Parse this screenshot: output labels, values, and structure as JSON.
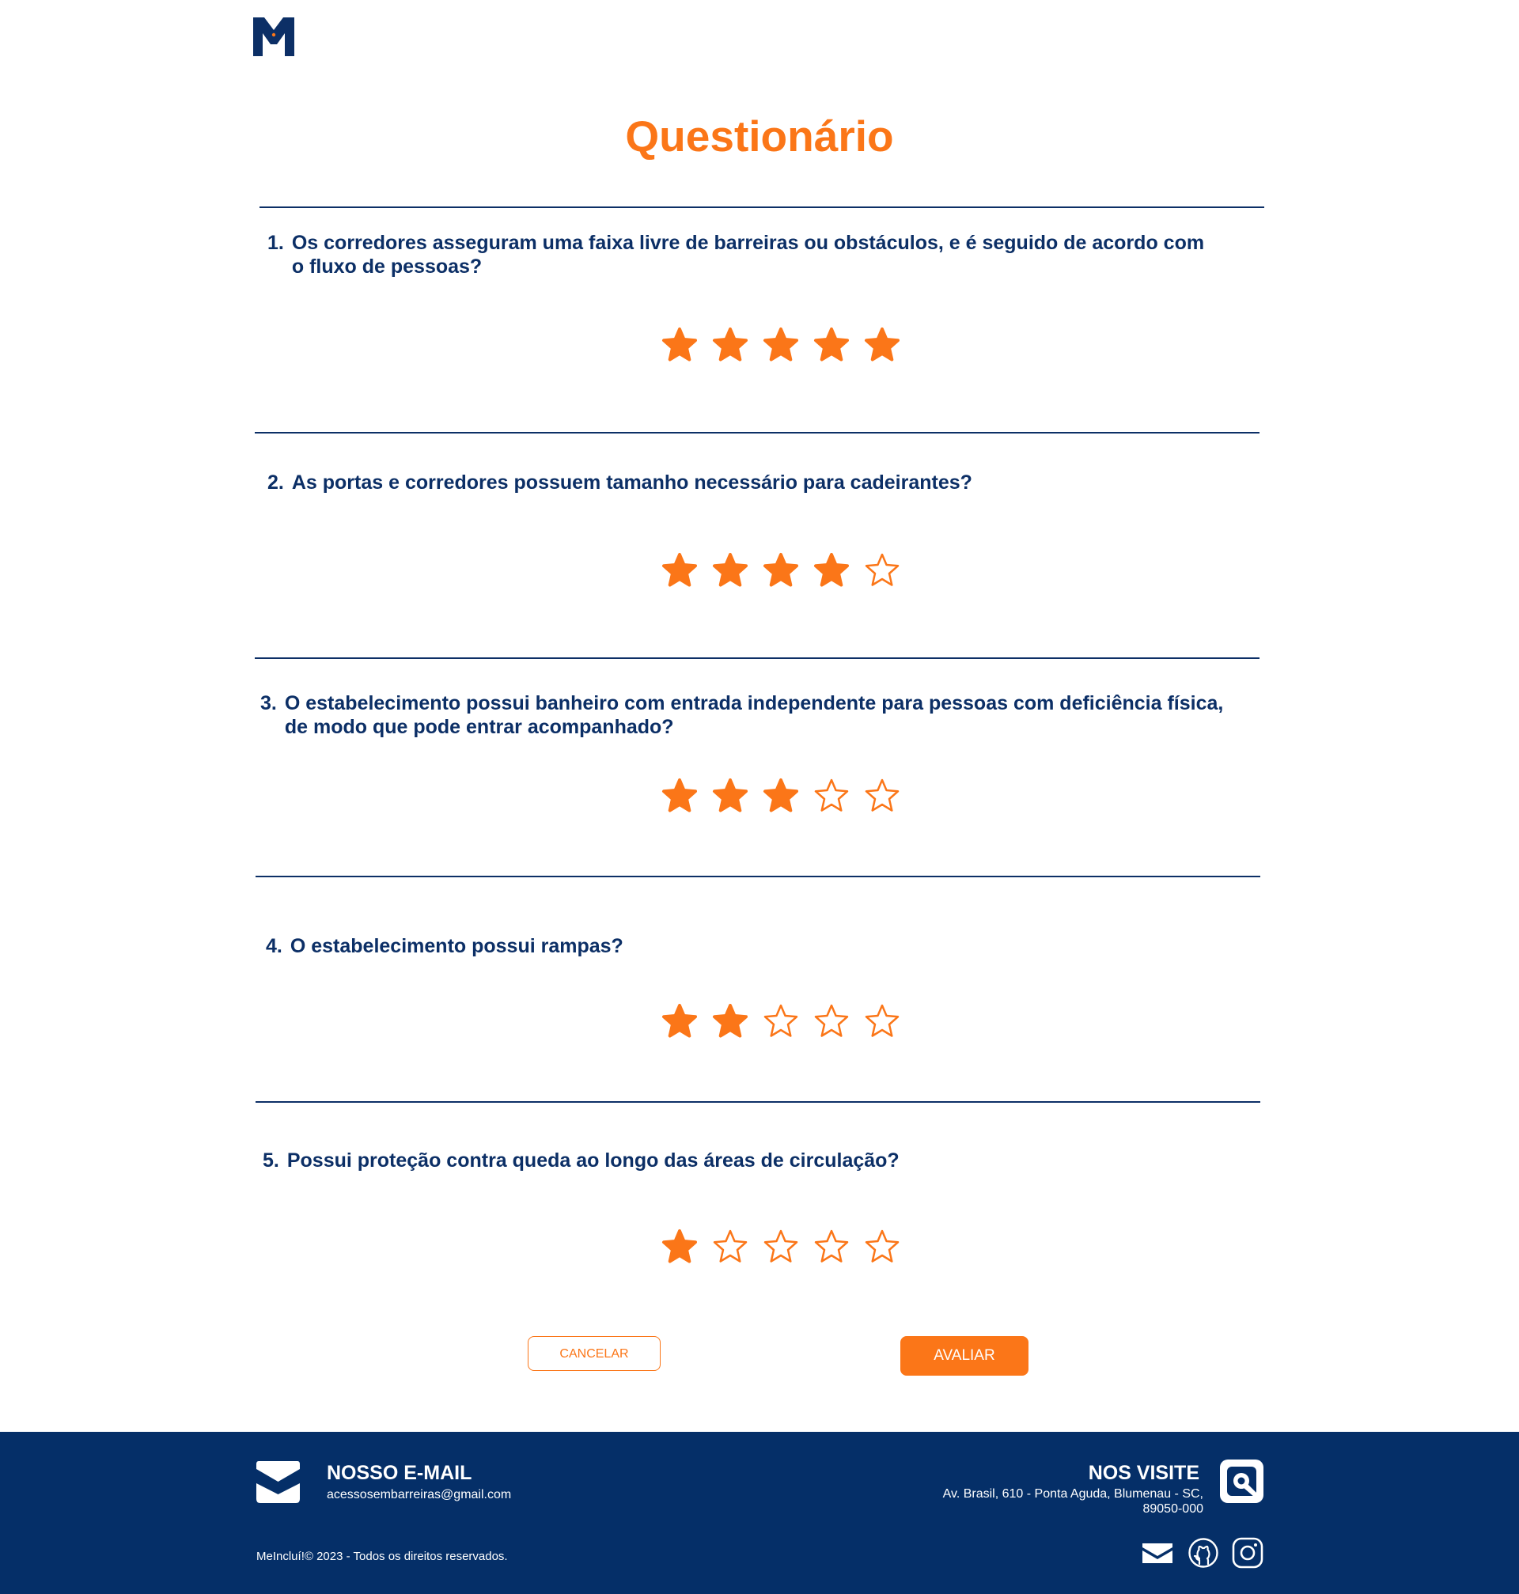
{
  "page": {
    "title": "Questionário"
  },
  "questions": [
    {
      "number": "1.",
      "text": "Os corredores asseguram uma faixa livre de barreiras ou obstáculos, e é seguido de acordo com o fluxo de pessoas?",
      "rating": 5,
      "max": 5
    },
    {
      "number": "2.",
      "text": "As portas e corredores possuem tamanho necessário para cadeirantes?",
      "rating": 4,
      "max": 5
    },
    {
      "number": "3.",
      "text": "O estabelecimento possui banheiro com entrada independente para pessoas com deficiência física, de modo que pode entrar acompanhado?",
      "rating": 3,
      "max": 5
    },
    {
      "number": "4.",
      "text": "O estabelecimento possui rampas?",
      "rating": 2,
      "max": 5
    },
    {
      "number": "5.",
      "text": "Possui proteção contra queda ao longo das áreas de circulação?",
      "rating": 1,
      "max": 5
    }
  ],
  "actions": {
    "cancel_label": "CANCELAR",
    "submit_label": "AVALIAR"
  },
  "footer": {
    "email_title": "NOSSO E-MAIL",
    "email_address": "acessosembarreiras@gmail.com",
    "visit_title": "NOS VISITE",
    "visit_address": "Av. Brasil, 610 - Ponta Aguda, Blumenau - SC, 89050-000",
    "copyright": "MeIncluí!© 2023 - Todos os direitos reservados.",
    "social_icons": [
      "mail-icon",
      "github-icon",
      "instagram-icon"
    ]
  },
  "colors": {
    "accent": "#fb7618",
    "brand": "#0c2f66",
    "footer_bg": "#052f68"
  }
}
